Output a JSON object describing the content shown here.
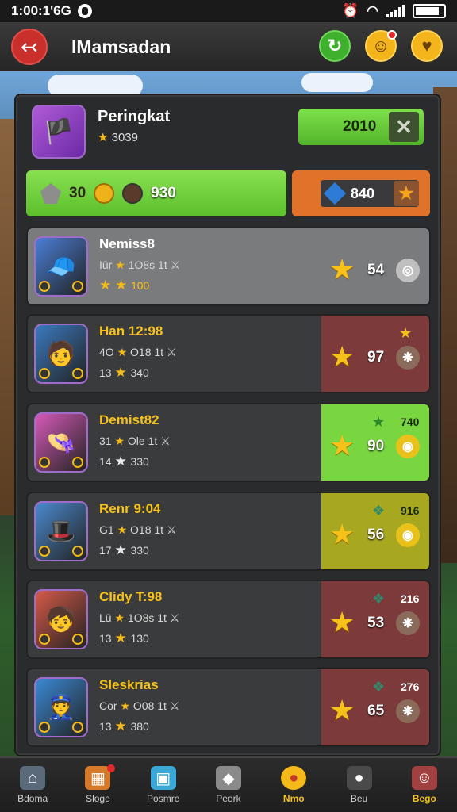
{
  "status": {
    "time": "1:00:1'6G"
  },
  "header": {
    "title": "IMamsadan",
    "back_icon": "back-arrow-icon"
  },
  "top": {
    "title": "Peringkat",
    "sub_star": "★",
    "sub_value": "3039",
    "score": "2010",
    "close": "✕"
  },
  "stats": {
    "green_v1": "30",
    "green_v2": "930",
    "orange_v": "840"
  },
  "rows": [
    {
      "name": "Nemiss8",
      "meta_a": "Iūr",
      "meta_b": "1O8s 1t",
      "meta2_a": "",
      "meta2_b": "100",
      "score": "54",
      "top_value": "",
      "avatar": "🧢",
      "avatar_bg": "#4a7ed6",
      "right_color": "#7a7b7d",
      "medal": "◎",
      "medal_bg": "#bfbfbf"
    },
    {
      "name": "Han 12:98",
      "meta_a": "4O",
      "meta_b": "O18 1t",
      "meta2_a": "13",
      "meta2_b": "340",
      "score": "97",
      "top_value": "",
      "avatar": "🧑",
      "avatar_bg": "#3a7ac0",
      "right_color": "#7d3a3a",
      "medal": "❋",
      "medal_bg": "#8a6a5a"
    },
    {
      "name": "Demist82",
      "meta_a": "31",
      "meta_b": "Ole 1t",
      "meta2_a": "14",
      "meta2_b": "330",
      "score": "90",
      "top_value": "740",
      "avatar": "👒",
      "avatar_bg": "#d65ab8",
      "right_color": "#79d640",
      "medal": "◉",
      "medal_bg": "#e8c21a"
    },
    {
      "name": "Renr 9:04",
      "meta_a": "G1",
      "meta_b": "O18 1t",
      "meta2_a": "17",
      "meta2_b": "330",
      "score": "56",
      "top_value": "916",
      "avatar": "🎩",
      "avatar_bg": "#4a8acf",
      "right_color": "#a8a820",
      "medal": "◉",
      "medal_bg": "#e8c21a"
    },
    {
      "name": "Clidy T:98",
      "meta_a": "Lū",
      "meta_b": "1O8s 1t",
      "meta2_a": "13",
      "meta2_b": "130",
      "score": "53",
      "top_value": "216",
      "avatar": "🧒",
      "avatar_bg": "#d65a4a",
      "right_color": "#7d3a3a",
      "medal": "❋",
      "medal_bg": "#8a6a5a"
    },
    {
      "name": "Sleskrias",
      "meta_a": "Cor",
      "meta_b": "O08 1t",
      "meta2_a": "13",
      "meta2_b": "380",
      "score": "65",
      "top_value": "276",
      "avatar": "👮",
      "avatar_bg": "#3a8ad6",
      "right_color": "#7d3a3a",
      "medal": "❋",
      "medal_bg": "#8a6a5a"
    }
  ],
  "nav": [
    {
      "label": "Bdoma",
      "icon": "home-icon",
      "glyph": "⌂",
      "bg": "#5a6a7a"
    },
    {
      "label": "Sloge",
      "icon": "shop-icon",
      "glyph": "▦",
      "bg": "#d67a2a",
      "dot": true
    },
    {
      "label": "Posmre",
      "icon": "chest-icon",
      "glyph": "▣",
      "bg": "#3aa8d6"
    },
    {
      "label": "Peork",
      "icon": "brick-icon",
      "glyph": "◆",
      "bg": "#8a8a8a"
    },
    {
      "label": "Nmo",
      "icon": "coin-icon",
      "glyph": "●",
      "bg": "#f6b91a",
      "active": true
    },
    {
      "label": "Beu",
      "icon": "bomb-icon",
      "glyph": "●",
      "bg": "#4a4a4a"
    },
    {
      "label": "Bego",
      "icon": "avatar-icon",
      "glyph": "☺",
      "bg": "#a04040",
      "active": true
    }
  ]
}
